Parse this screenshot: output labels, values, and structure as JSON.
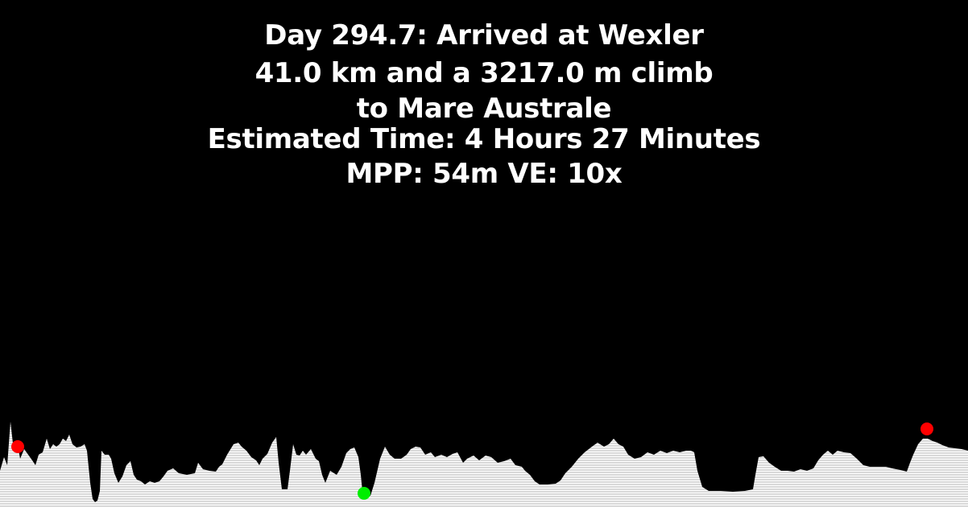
{
  "header": {
    "line1": "Day 294.7: Arrived at Wexler",
    "line2": "41.0 km and a 3217.0 m climb",
    "line3": "to Mare Australe",
    "line4": "Estimated Time: 4 Hours 27 Minutes",
    "line5": "MPP: 54m VE: 10x"
  },
  "colors": {
    "background": "#000000",
    "terrain_fill": "#d9d9d9",
    "terrain_stripe": "#ffffff",
    "current_position": "#00ee00",
    "endpoint": "#ff0000"
  }
}
